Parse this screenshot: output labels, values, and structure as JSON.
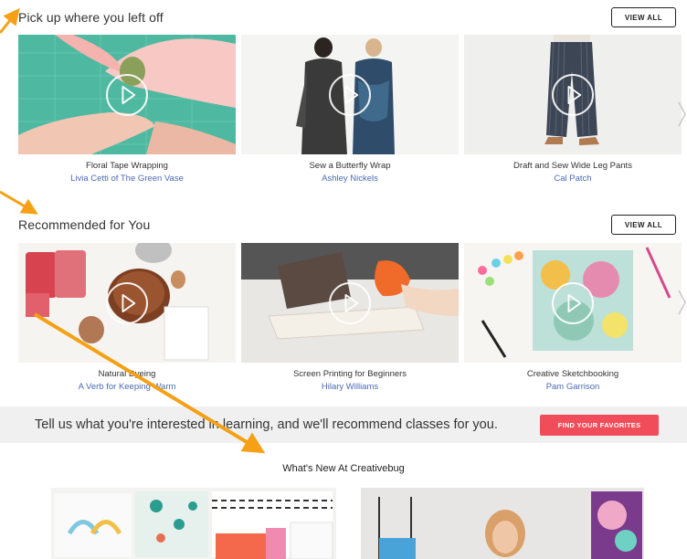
{
  "sections": [
    {
      "title": "Pick up where you left off",
      "view_all": "VIEW ALL",
      "cards": [
        {
          "title": "Floral Tape Wrapping",
          "author": "Livia Cetti of The Green Vase"
        },
        {
          "title": "Sew a Butterfly Wrap",
          "author": "Ashley Nickels"
        },
        {
          "title": "Draft and Sew Wide Leg Pants",
          "author": "Cal Patch"
        }
      ]
    },
    {
      "title": "Recommended for You",
      "view_all": "VIEW ALL",
      "cards": [
        {
          "title": "Natural Dyeing",
          "author": "A Verb for Keeping Warm"
        },
        {
          "title": "Screen Printing for Beginners",
          "author": "Hilary Williams"
        },
        {
          "title": "Creative Sketchbooking",
          "author": "Pam Garrison"
        }
      ]
    }
  ],
  "banner": {
    "text": "Tell us what you're interested in learning, and we'll recommend classes for you.",
    "button": "FIND YOUR FAVORITES"
  },
  "whats_new": "What's New At Creativebug",
  "colors": {
    "accent_button": "#f04c5a",
    "author_link": "#4a6bb5",
    "annotation_arrow": "#f5a015",
    "banner_bg": "#f0f0f0"
  },
  "icons": [
    "play-icon",
    "chevron-right-icon",
    "annotation-arrow-icon"
  ]
}
